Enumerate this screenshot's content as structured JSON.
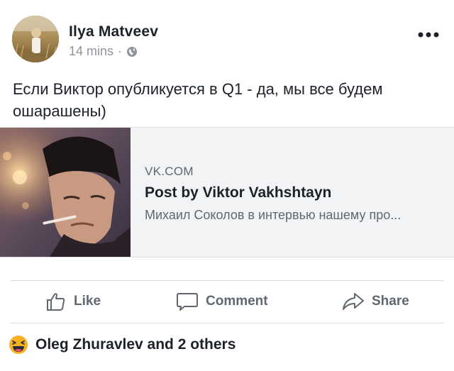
{
  "post": {
    "author": "Ilya Matveev",
    "time": "14 mins",
    "separator": "·",
    "privacy_icon": "globe-icon",
    "text": "Если Виктор опубликуется в Q1 - да, мы все будем ошарашены)"
  },
  "link_preview": {
    "domain": "VK.COM",
    "title": "Post by Viktor Vakhshtayn",
    "description": "Михаил Соколов в интервью нашему про..."
  },
  "actions": {
    "like": "Like",
    "comment": "Comment",
    "share": "Share"
  },
  "reactions": {
    "icon": "haha-emoji-icon",
    "summary": "Oleg Zhuravlev and 2 others"
  },
  "colors": {
    "text": "#1d2129",
    "secondary": "#606770",
    "muted": "#90949c",
    "card_bg": "#f2f3f5",
    "divider": "#dddfe2",
    "haha": "#f7b125"
  }
}
